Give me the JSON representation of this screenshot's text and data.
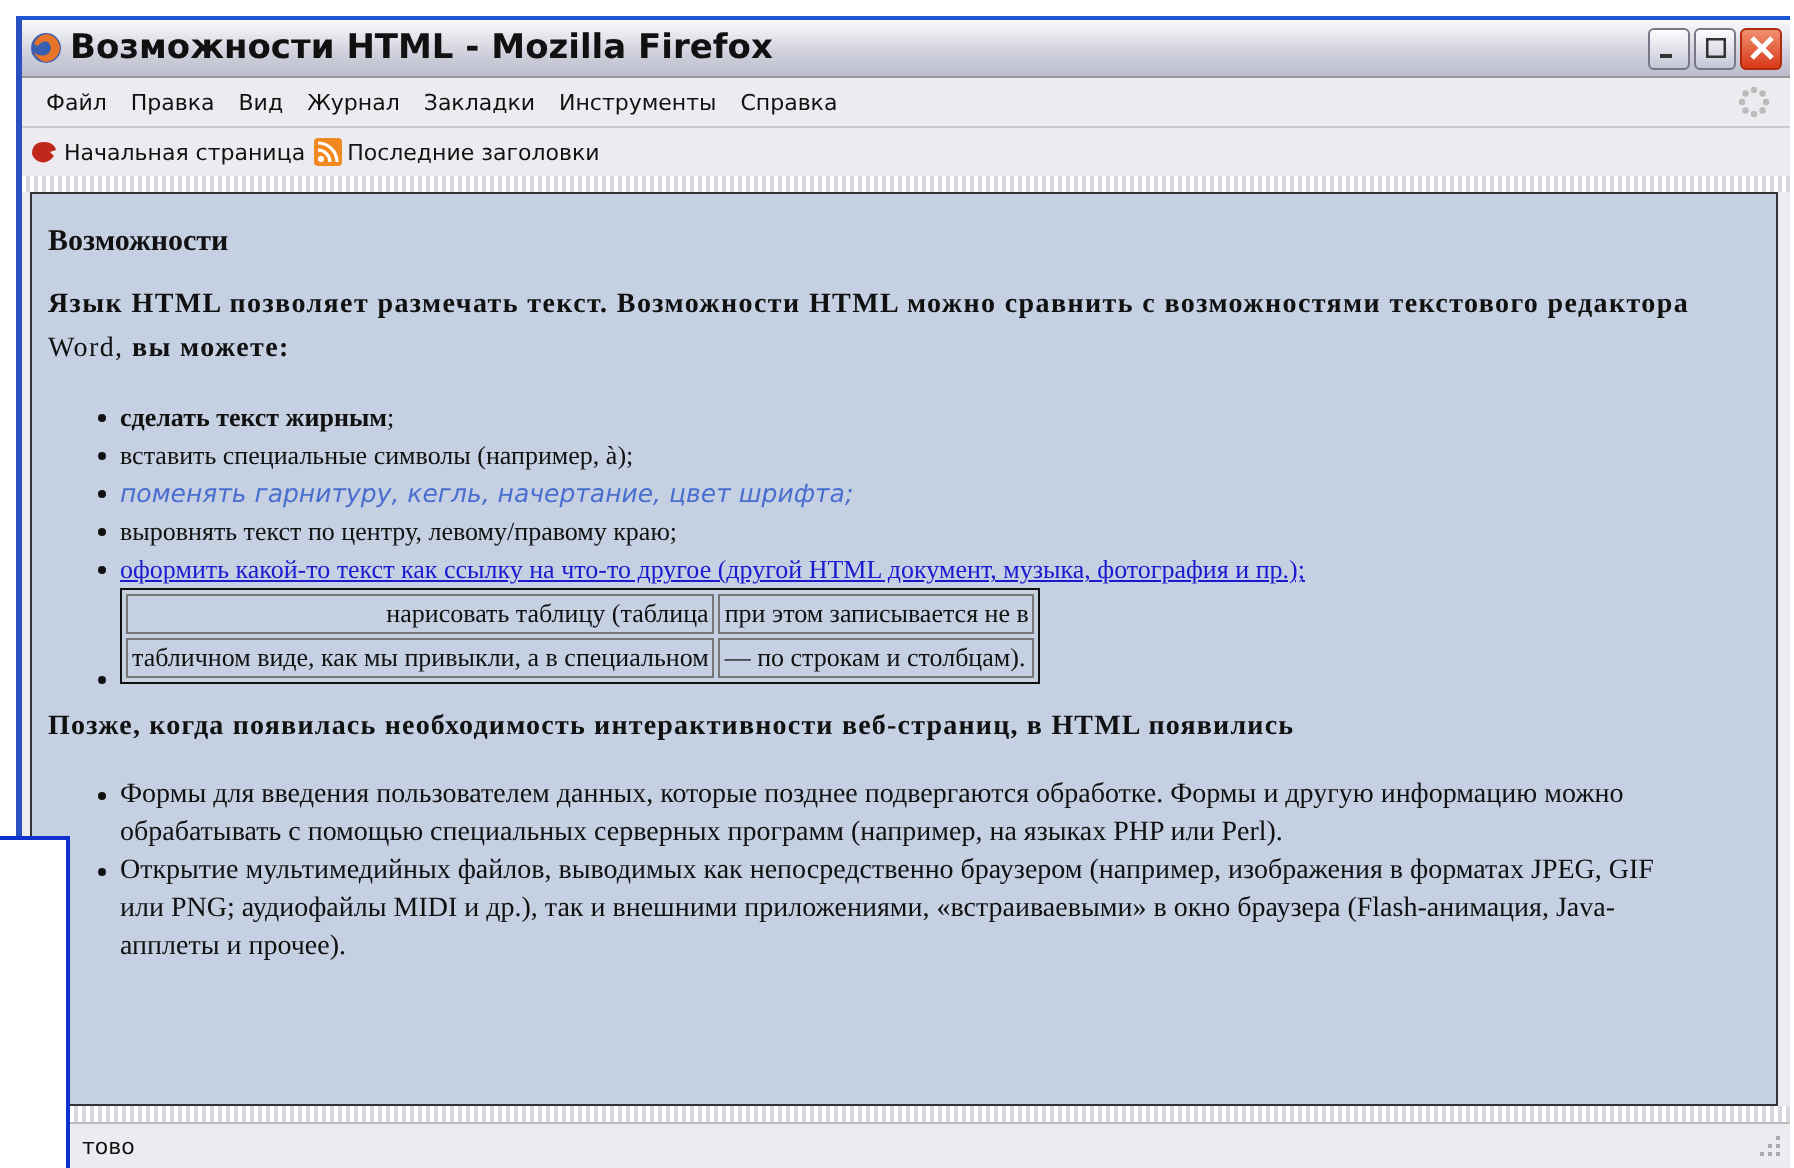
{
  "window": {
    "title": "Возможности HTML - Mozilla Firefox"
  },
  "menu": [
    "Файл",
    "Правка",
    "Вид",
    "Журнал",
    "Закладки",
    "Инструменты",
    "Справка"
  ],
  "bookmarks": [
    {
      "label": "Начальная страница",
      "kind": "home"
    },
    {
      "label": "Последние заголовки",
      "kind": "feed"
    }
  ],
  "page": {
    "heading": "Возможности",
    "intro": "**Язык HTML позволяет размечать текст. Возможности HTML можно сравнить с возможностями текстового редактора** Word, **вы можете:**",
    "items": [
      {
        "kind": "text",
        "text": "**сделать текст жирным**;"
      },
      {
        "kind": "text",
        "text": "вставить специальные символы (например, à);"
      },
      {
        "kind": "styled",
        "text": "поменять гарнитуру, кегль, начертание, цвет шрифта;"
      },
      {
        "kind": "text",
        "text": "выровнять текст по центру, левому/правому краю;"
      },
      {
        "kind": "link",
        "text": "оформить какой-то текст как ссылку на что-то другое (другой HTML документ, музыка, фотография и пр.);"
      },
      {
        "kind": "table",
        "rows": [
          [
            "нарисовать таблицу (таблица",
            "при этом записывается не в"
          ],
          [
            "табличном виде, как мы привыкли, а в специальном",
            "— по строкам и столбцам)."
          ]
        ]
      }
    ],
    "second": "Позже, когда появилась необходимость интерактивности веб-страниц, в HTML появились",
    "items2": [
      "Формы для введения пользователем данных, которые позднее подвергаются обработке. Формы и другую информацию можно обрабатывать с помощью специальных серверных программ (например, на языках PHP или Perl).",
      "Открытие мультимедийных файлов, выводимых как непосредственно браузером (например, изображения в форматах JPEG, GIF или PNG; аудиофайлы MIDI и др.), так и внешними приложениями, «встраиваевыми» в окно браузера (Flash-анимация, Java-апплеты и прочее)."
    ]
  },
  "status_bar": "тово"
}
